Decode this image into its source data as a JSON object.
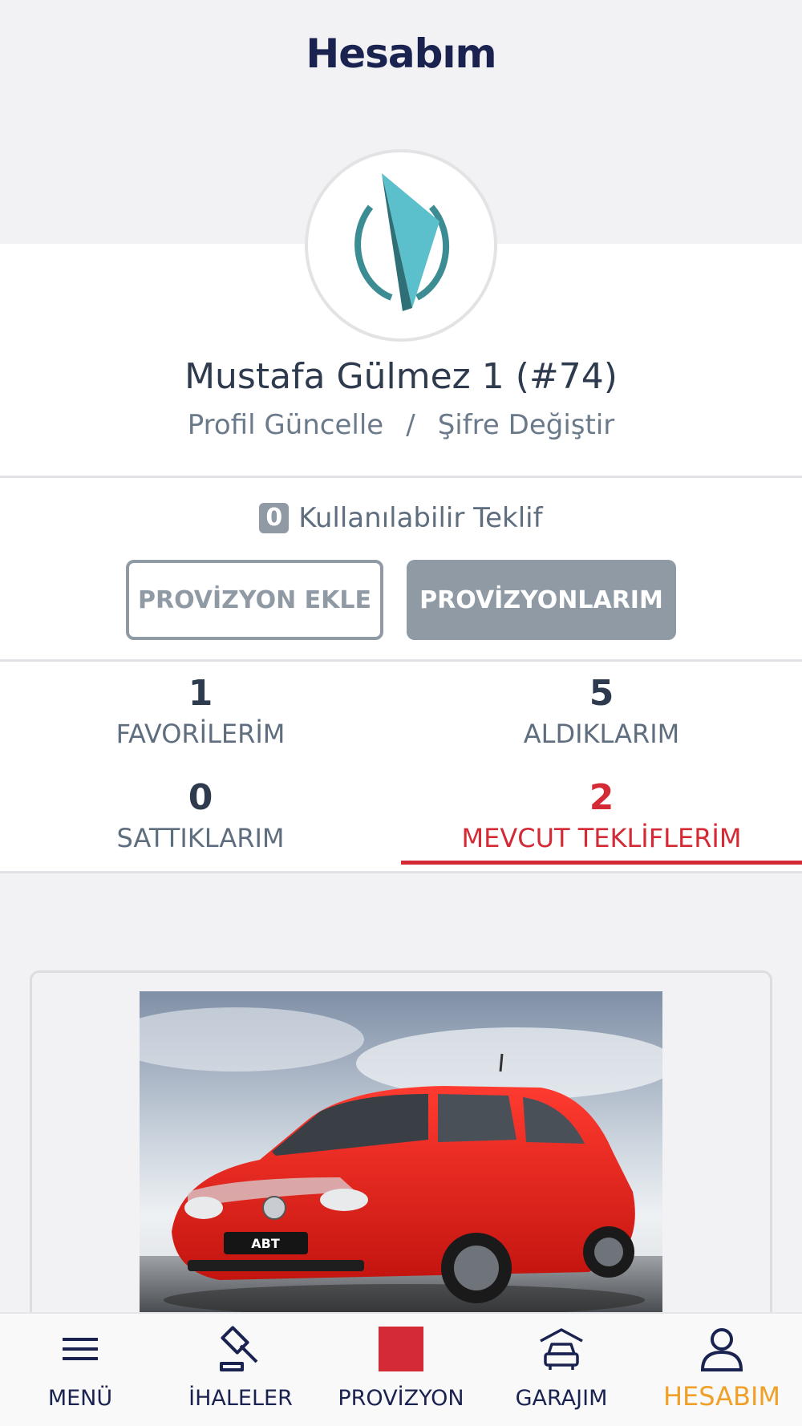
{
  "header": {
    "title": "Hesabım"
  },
  "profile": {
    "name": "Mustafa Gülmez 1 (#74)",
    "update_link": "Profil Güncelle",
    "separator": "/",
    "password_link": "Şifre Değiştir"
  },
  "offers": {
    "count": "0",
    "label": "Kullanılabilir Teklif",
    "add_button": "PROVİZYON EKLE",
    "list_button": "PROVİZYONLARIM"
  },
  "stats": [
    {
      "value": "1",
      "label": "FAVORİLERİM"
    },
    {
      "value": "5",
      "label": "ALDIKLARIM"
    },
    {
      "value": "0",
      "label": "SATTIKLARIM"
    },
    {
      "value": "2",
      "label": "MEVCUT TEKLİFLERİM"
    }
  ],
  "active_stat": "MEVCUT TEKLİFLERİM",
  "tabbar": {
    "items": [
      {
        "label": "MENÜ",
        "icon": "hamburger-icon"
      },
      {
        "label": "İHALELER",
        "icon": "gavel-icon"
      },
      {
        "label": "PROVİZYON",
        "icon": "red-square-icon"
      },
      {
        "label": "GARAJIM",
        "icon": "garage-car-icon"
      },
      {
        "label": "HESABIM",
        "icon": "user-icon"
      }
    ],
    "active": "HESABIM"
  },
  "colors": {
    "accent_red": "#d32a35",
    "active_tab": "#f0a028",
    "title_navy": "#1a2250",
    "button_gray": "#8f9aa5"
  }
}
